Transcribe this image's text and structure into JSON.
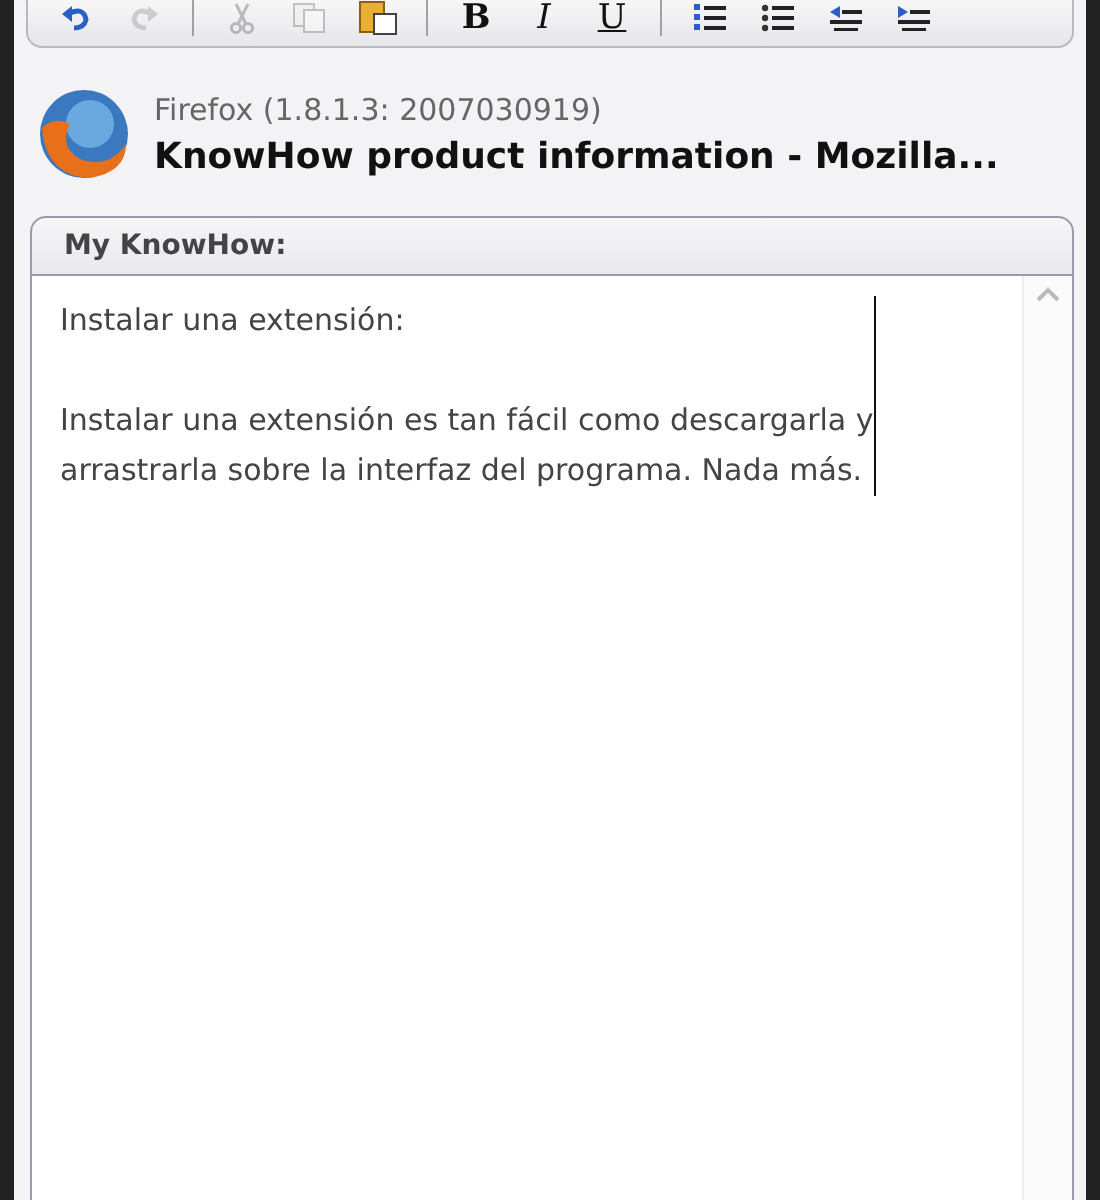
{
  "toolbar": {
    "groups": [
      [
        {
          "kind": "undo",
          "disabled": false
        },
        {
          "kind": "redo",
          "disabled": true
        }
      ],
      [
        {
          "kind": "cut",
          "disabled": true
        },
        {
          "kind": "copy",
          "disabled": true
        },
        {
          "kind": "paste",
          "disabled": false
        }
      ],
      [
        {
          "kind": "bold",
          "label": "B",
          "disabled": false
        },
        {
          "kind": "italic",
          "label": "I",
          "disabled": false
        },
        {
          "kind": "underline",
          "label": "U",
          "disabled": false
        }
      ],
      [
        {
          "kind": "numbered",
          "disabled": false
        },
        {
          "kind": "bullets",
          "disabled": false
        },
        {
          "kind": "outdent",
          "disabled": false
        },
        {
          "kind": "indent",
          "disabled": false
        }
      ]
    ]
  },
  "header": {
    "app": "Firefox (1.8.1.3: 2007030919)",
    "title": "KnowHow product information - Mozilla..."
  },
  "panel": {
    "title": "My KnowHow:",
    "value": "Instalar una extensión:\n\nInstalar una extensión es tan fácil como descargarla y\narrastrarla sobre la interfaz del programa. Nada más."
  }
}
